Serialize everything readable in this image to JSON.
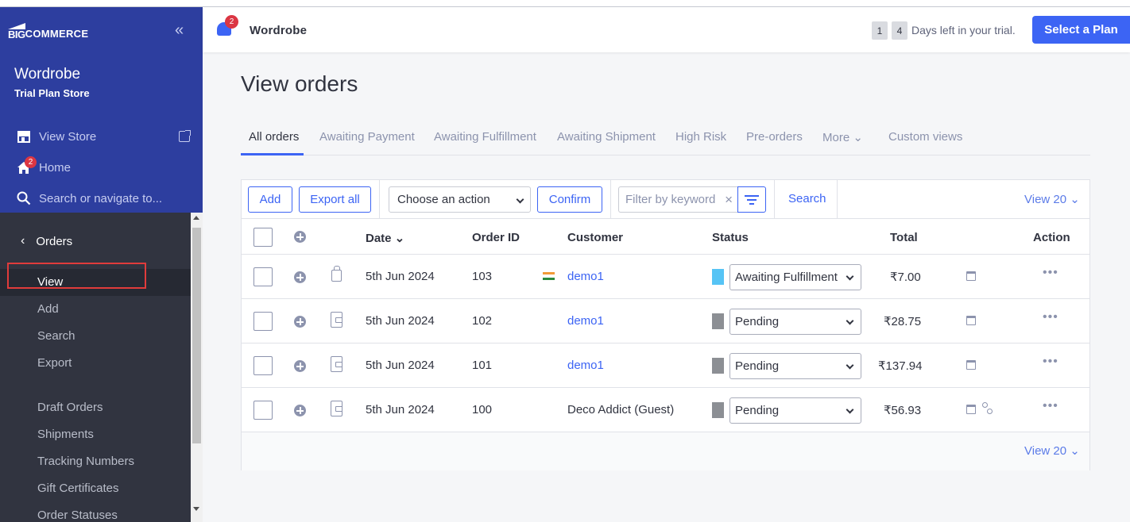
{
  "sidebar": {
    "logo": {
      "mark": "BIG",
      "text": "COMMERCE"
    },
    "collapse_icon": "«",
    "store_name": "Wordrobe",
    "store_plan": "Trial Plan Store",
    "view_store": "View Store",
    "home": "Home",
    "home_badge": "2",
    "search": "Search or navigate to...",
    "section": "Orders",
    "items": [
      {
        "label": "View",
        "active": true
      },
      {
        "label": "Add"
      },
      {
        "label": "Search"
      },
      {
        "label": "Export"
      },
      {
        "label": "Draft Orders"
      },
      {
        "label": "Shipments"
      },
      {
        "label": "Tracking Numbers"
      },
      {
        "label": "Gift Certificates"
      },
      {
        "label": "Order Statuses"
      }
    ]
  },
  "header": {
    "notification_badge": "2",
    "store_name": "Wordrobe",
    "trial_digits": [
      "1",
      "4"
    ],
    "trial_text": "Days left in your trial.",
    "plan_button": "Select a Plan"
  },
  "main": {
    "title": "View orders",
    "tabs": [
      {
        "label": "All orders",
        "active": true
      },
      {
        "label": "Awaiting Payment"
      },
      {
        "label": "Awaiting Fulfillment"
      },
      {
        "label": "Awaiting Shipment"
      },
      {
        "label": "High Risk"
      },
      {
        "label": "Pre-orders"
      },
      {
        "label": "More ⌄"
      },
      {
        "label": "Custom views"
      }
    ],
    "toolbar": {
      "add": "Add",
      "export_all": "Export all",
      "action_select": "Choose an action",
      "confirm": "Confirm",
      "filter_placeholder": "Filter by keyword",
      "clear": "×",
      "search": "Search",
      "view20": "View 20 ⌄"
    },
    "columns": {
      "date": "Date ⌄",
      "order_id": "Order ID",
      "customer": "Customer",
      "status": "Status",
      "total": "Total",
      "action": "Action"
    },
    "rows": [
      {
        "date": "5th Jun 2024",
        "order_id": "103",
        "customer": "demo1",
        "status": "Awaiting Fulfillment",
        "status_color": "#56c4f5",
        "total": "₹7.00"
      },
      {
        "date": "5th Jun 2024",
        "order_id": "102",
        "customer": "demo1",
        "status": "Pending",
        "status_color": "#8c8f94",
        "total": "₹28.75"
      },
      {
        "date": "5th Jun 2024",
        "order_id": "101",
        "customer": "demo1",
        "status": "Pending",
        "status_color": "#8c8f94",
        "total": "₹137.94"
      },
      {
        "date": "5th Jun 2024",
        "order_id": "100",
        "customer": "Deco Addict (Guest)",
        "status": "Pending",
        "status_color": "#8c8f94",
        "total": "₹56.93"
      }
    ],
    "dots": "•••",
    "footer_view20": "View 20 ⌄"
  },
  "colors": {
    "brand": "#3c64f4",
    "sidebar_top": "#2d3e9f",
    "sidebar": "#313440",
    "highlight": "#e03b3b"
  }
}
